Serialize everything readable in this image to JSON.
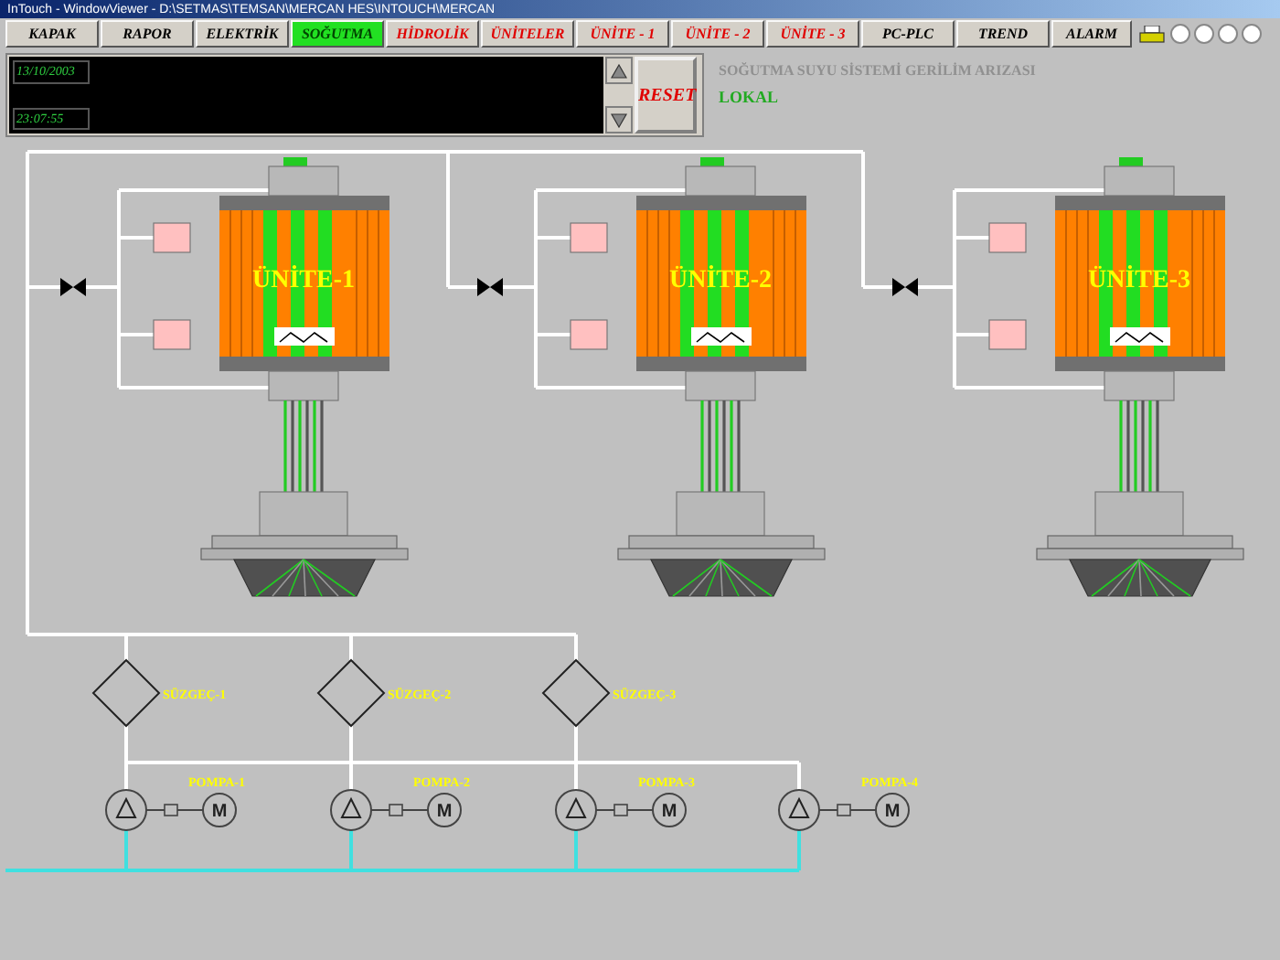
{
  "window": {
    "title": "InTouch - WindowViewer - D:\\SETMAS\\TEMSAN\\MERCAN HES\\INTOUCH\\MERCAN"
  },
  "nav": [
    {
      "label": "KAPAK",
      "selected": false,
      "alarm": false
    },
    {
      "label": "RAPOR",
      "selected": false,
      "alarm": false
    },
    {
      "label": "ELEKTRİK",
      "selected": false,
      "alarm": false
    },
    {
      "label": "SOĞUTMA",
      "selected": true,
      "alarm": false
    },
    {
      "label": "HİDROLİK",
      "selected": false,
      "alarm": true
    },
    {
      "label": "ÜNİTELER",
      "selected": false,
      "alarm": true
    },
    {
      "label": "ÜNİTE - 1",
      "selected": false,
      "alarm": true
    },
    {
      "label": "ÜNİTE - 2",
      "selected": false,
      "alarm": true
    },
    {
      "label": "ÜNİTE - 3",
      "selected": false,
      "alarm": true
    },
    {
      "label": "PC-PLC",
      "selected": false,
      "alarm": false
    },
    {
      "label": "TREND",
      "selected": false,
      "alarm": false
    },
    {
      "label": "ALARM",
      "selected": false,
      "alarm": false
    }
  ],
  "status_panel": {
    "date": "13/10/2003",
    "time": "23:07:55",
    "reset_label": "RESET"
  },
  "message": "SOĞUTMA SUYU SİSTEMİ GERİLİM ARIZASI",
  "mode": "LOKAL",
  "units": [
    {
      "label": "ÜNİTE-1"
    },
    {
      "label": "ÜNİTE-2"
    },
    {
      "label": "ÜNİTE-3"
    }
  ],
  "filters": [
    {
      "label": "SÜZGEÇ-1"
    },
    {
      "label": "SÜZGEÇ-2"
    },
    {
      "label": "SÜZGEÇ-3"
    }
  ],
  "pumps": [
    {
      "label": "POMPA-1",
      "motor_symbol": "M"
    },
    {
      "label": "POMPA-2",
      "motor_symbol": "M"
    },
    {
      "label": "POMPA-3",
      "motor_symbol": "M"
    },
    {
      "label": "POMPA-4",
      "motor_symbol": "M"
    }
  ]
}
